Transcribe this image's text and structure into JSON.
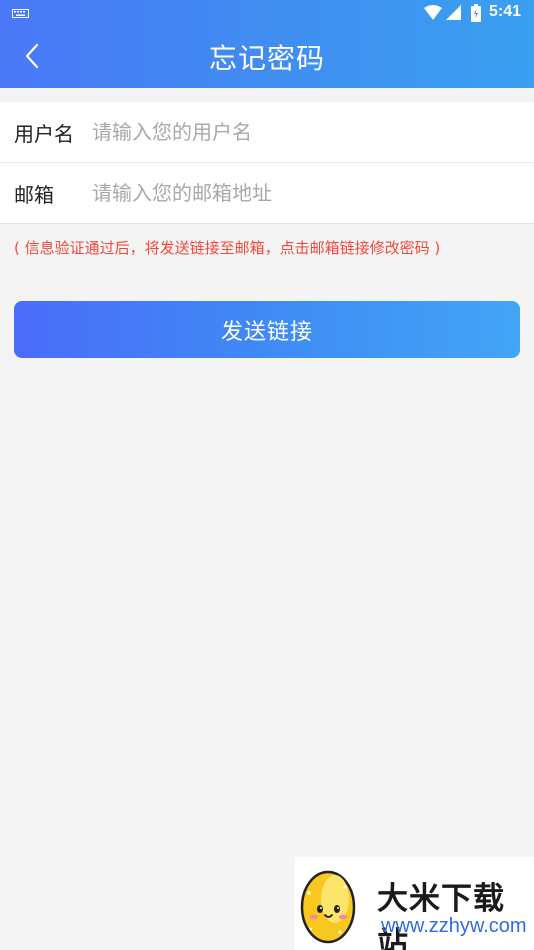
{
  "status_bar": {
    "time": "5:41",
    "icons": [
      "keyboard-icon",
      "wifi-icon",
      "signal-icon",
      "battery-icon"
    ]
  },
  "header": {
    "title": "忘记密码",
    "back_icon": "chevron-left-icon"
  },
  "form": {
    "username": {
      "label": "用户名",
      "placeholder": "请输入您的用户名",
      "value": ""
    },
    "email": {
      "label": "邮箱",
      "placeholder": "请输入您的邮箱地址",
      "value": ""
    }
  },
  "hint": "( 信息验证通过后，将发送链接至邮箱，点击邮箱链接修改密码 )",
  "send_button": {
    "label": "发送链接"
  },
  "watermark": {
    "name": "大米下载站",
    "url": "www.zzhyw.com"
  },
  "colors": {
    "header_gradient_start": "#4a78f7",
    "header_gradient_end": "#3aa0f0",
    "button_gradient_start": "#4a6cf8",
    "button_gradient_end": "#43a5f7",
    "hint": "#f04a3a",
    "background": "#f4f4f4"
  }
}
